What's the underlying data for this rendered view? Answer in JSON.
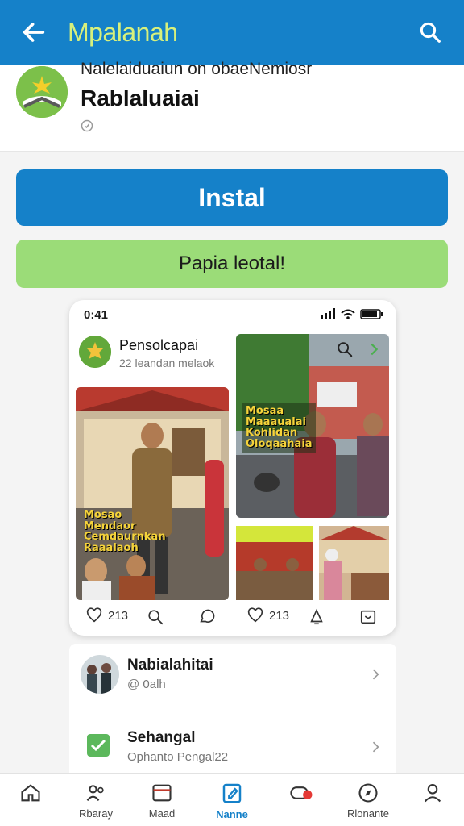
{
  "appbar": {
    "title": "Mpalanah"
  },
  "app": {
    "publisher": "Nalelaiduaiun on obaeNemiosr",
    "name": "Rablaluaiai"
  },
  "buttons": {
    "install": "Instal",
    "secondary": "Papia leotal!"
  },
  "preview": {
    "status_time": "0:41",
    "post_title": "Pensolcapai",
    "post_sub": "22 leandan melaok",
    "overlay_left": [
      "Mosao",
      "Mendaor",
      "Cemdaurnkan",
      "Raaalaoh"
    ],
    "overlay_right": [
      "Mosaa",
      "Maaaualai",
      "Kohlidan",
      "Oloqaahaia"
    ],
    "actions": {
      "likes_left": "213",
      "likes_right": "213"
    }
  },
  "list": [
    {
      "title": "Nabialahitai",
      "subtitle": "@ 0alh"
    },
    {
      "title": "Sehangal",
      "subtitle": "Ophanto Pengal22"
    }
  ],
  "nav": [
    {
      "label": "",
      "icon": "home-icon"
    },
    {
      "label": "Rbaray",
      "icon": "people-icon"
    },
    {
      "label": "Maad",
      "icon": "media-icon"
    },
    {
      "label": "Nanne",
      "icon": "edit-icon",
      "active": true
    },
    {
      "label": "",
      "icon": "notification-icon"
    },
    {
      "label": "Rlonante",
      "icon": "compass-icon"
    },
    {
      "label": "",
      "icon": "profile-icon"
    }
  ],
  "colors": {
    "primary": "#1581c9",
    "accent_green": "#9bdc78",
    "title_yellow": "#d7f07c"
  }
}
